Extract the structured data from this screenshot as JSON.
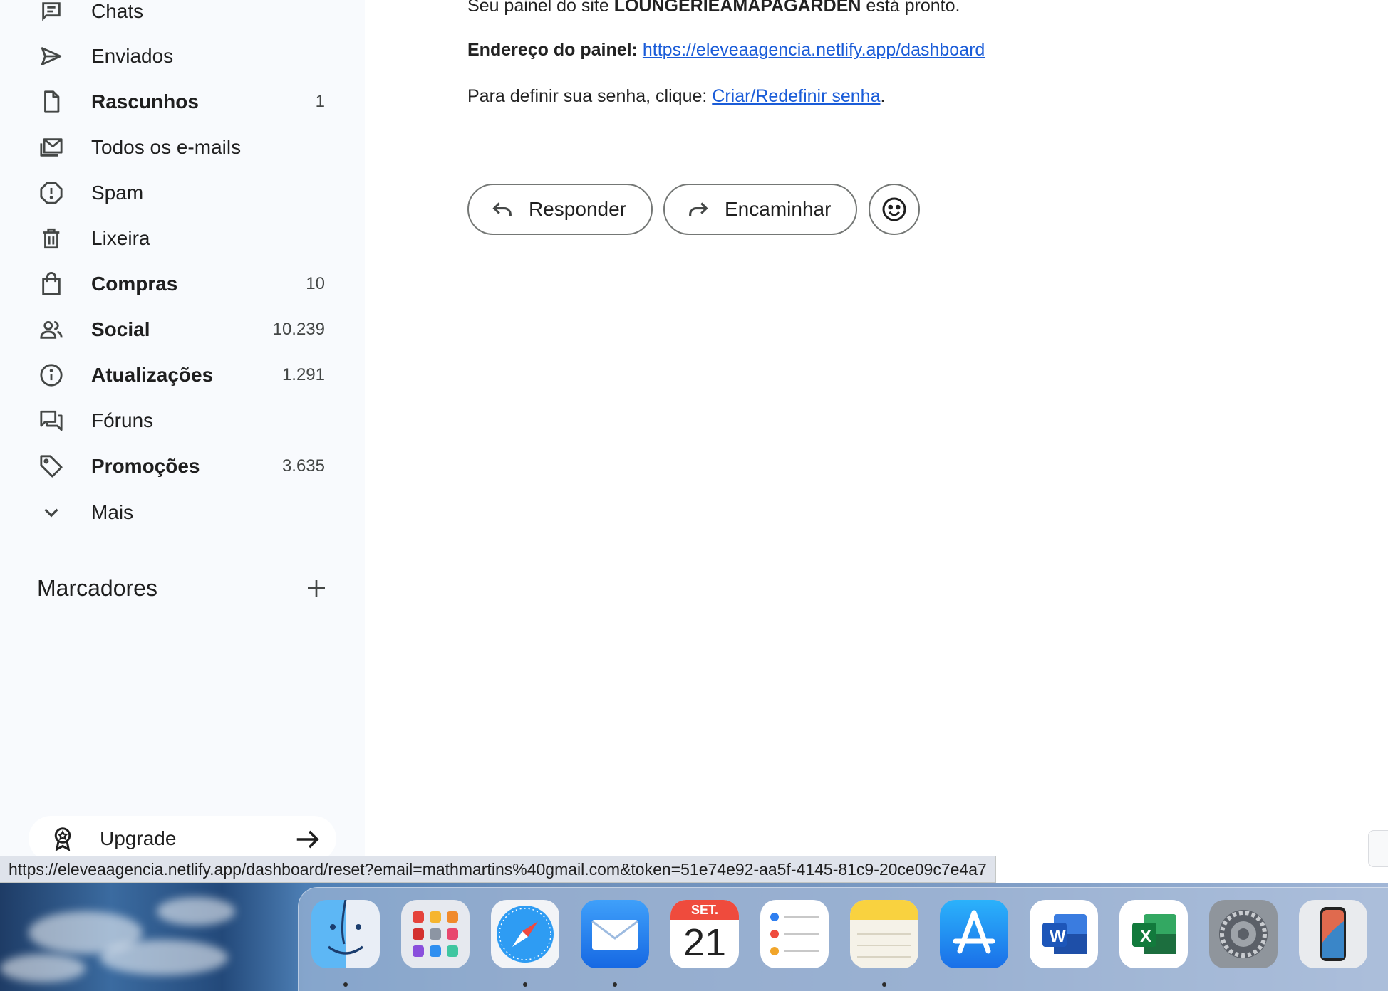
{
  "sidebar": {
    "items": [
      {
        "label": "Chats",
        "count": "",
        "bold": false,
        "icon": "chat-icon"
      },
      {
        "label": "Enviados",
        "count": "",
        "bold": false,
        "icon": "send-icon"
      },
      {
        "label": "Rascunhos",
        "count": "1",
        "bold": true,
        "icon": "draft-file-icon"
      },
      {
        "label": "Todos os e-mails",
        "count": "",
        "bold": false,
        "icon": "all-mail-icon"
      },
      {
        "label": "Spam",
        "count": "",
        "bold": false,
        "icon": "spam-icon"
      },
      {
        "label": "Lixeira",
        "count": "",
        "bold": false,
        "icon": "trash-icon"
      },
      {
        "label": "Compras",
        "count": "10",
        "bold": true,
        "icon": "shopping-bag-icon"
      },
      {
        "label": "Social",
        "count": "10.239",
        "bold": true,
        "icon": "people-icon"
      },
      {
        "label": "Atualizações",
        "count": "1.291",
        "bold": true,
        "icon": "info-icon"
      },
      {
        "label": "Fóruns",
        "count": "",
        "bold": false,
        "icon": "forum-icon"
      },
      {
        "label": "Promoções",
        "count": "3.635",
        "bold": true,
        "icon": "tag-icon"
      },
      {
        "label": "Mais",
        "count": "",
        "bold": false,
        "icon": "chevron-down-icon"
      }
    ],
    "markers_title": "Marcadores",
    "upgrade_label": "Upgrade"
  },
  "message": {
    "line1_prefix": "Seu painel do site ",
    "line1_site": "LOUNGERIEAMAPAGARDEN",
    "line1_suffix": " está pronto.",
    "line2_label": "Endereço do painel:",
    "line2_link": "https://eleveaagencia.netlify.app/dashboard",
    "line3_prefix": "Para definir sua senha, clique: ",
    "line3_link": "Criar/Redefinir senha",
    "line3_suffix": ".",
    "reply_label": "Responder",
    "forward_label": "Encaminhar"
  },
  "status_bar_url": "https://eleveaagencia.netlify.app/dashboard/reset?email=mathmartins%40gmail.com&token=51e74e92-aa5f-4145-81c9-20ce09c7e4a7",
  "dock": {
    "apps": [
      "Finder",
      "Launchpad",
      "Safari",
      "Mail",
      "Calendar",
      "Reminders",
      "Notes",
      "App Store",
      "Word",
      "Excel",
      "System Settings",
      "iPhone Mirroring"
    ],
    "calendar_month": "SET.",
    "calendar_day": "21",
    "word_letter": "W",
    "excel_letter": "X"
  },
  "colors": {
    "link": "#1a5cd8",
    "sidebar_bg": "#f8fafd",
    "button_border": "#747775"
  }
}
